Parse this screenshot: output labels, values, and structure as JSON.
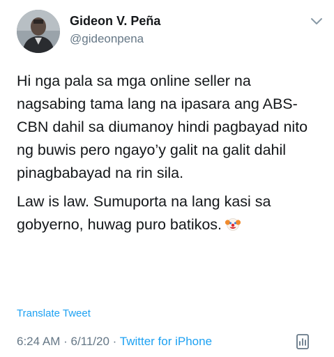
{
  "author": {
    "name": "Gideon V. Peña",
    "handle": "@gideonpena"
  },
  "tweet": {
    "paragraphs": [
      "Hi nga pala sa mga online seller na nagsabing tama lang na ipasara ang ABS-CBN dahil sa diumanoy hindi pagbayad nito ng buwis pero ngayo’y galit na galit dahil pinagbabayad na rin sila.",
      "Law is law. Sumuporta na lang kasi sa gobyerno, huwag puro batikos."
    ],
    "emoji": "clown-face"
  },
  "translate_label": "Translate Tweet",
  "meta": {
    "time": "6:24 AM",
    "separator1": " · ",
    "date": "6/11/20",
    "separator2": " · ",
    "source": "Twitter for iPhone"
  },
  "icons": {
    "menu": "chevron-down-icon",
    "analytics": "analytics-icon"
  },
  "colors": {
    "link": "#1da1f2",
    "secondary": "#657786",
    "text": "#14171a"
  }
}
